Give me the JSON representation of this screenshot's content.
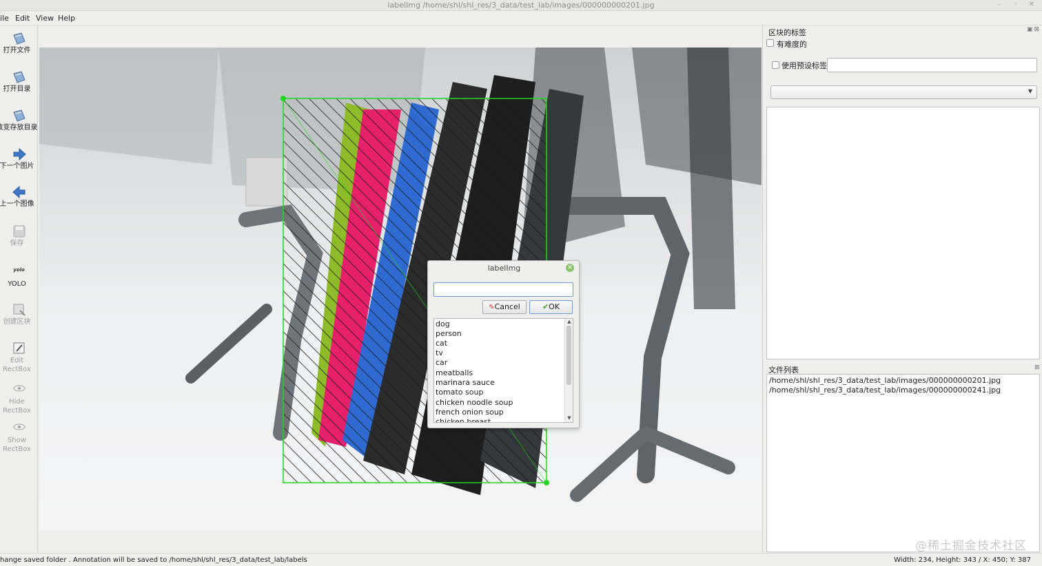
{
  "window": {
    "title": "labelImg /home/shl/shl_res/3_data/test_lab/images/000000000201.jpg",
    "controls": [
      "–",
      "◦",
      "✕"
    ]
  },
  "menu": {
    "items": [
      "ile",
      "Edit",
      "View",
      "Help"
    ]
  },
  "toolbar": {
    "open_file": "打开文件",
    "open_dir": "打开目录",
    "change_save_dir": "改变存放目录",
    "next_image": "下一个图片",
    "prev_image": "上一个图像",
    "save": "保存",
    "format_small": "yolo",
    "format": "YOLO",
    "create_box": "创建区块",
    "edit_box": [
      "Edit",
      "RectBox"
    ],
    "hide_box": [
      "Hide",
      "RectBox"
    ],
    "show_box": [
      "Show",
      "RectBox"
    ]
  },
  "dialog": {
    "title": "labelImg",
    "input_value": "",
    "cancel_label": "Cancel",
    "ok_label": "OK",
    "labels": [
      "dog",
      "person",
      "cat",
      "tv",
      "car",
      "meatballs",
      "marinara sauce",
      "tomato soup",
      "chicken noodle soup",
      "french onion soup",
      "chicken breast"
    ]
  },
  "right_panel": {
    "box_labels_title": "区块的标签",
    "difficult_label": "有难度的",
    "use_default_label": "使用预设标签",
    "default_label_value": "",
    "combo_value": "",
    "file_list_title": "文件列表",
    "files": [
      "/home/shl/shl_res/3_data/test_lab/images/000000000201.jpg",
      "/home/shl/shl_res/3_data/test_lab/images/000000000241.jpg"
    ]
  },
  "status": {
    "left": "hange saved folder . Annotation will be saved to /home/shl/shl_res/3_data/test_lab/labels",
    "right": "Width: 234, Height: 343 / X: 450; Y: 387"
  },
  "watermark": "@稀土掘金技术社区",
  "colors": {
    "bbox": "#22d622",
    "accent": "#6c9bd2",
    "ok_green": "#3a9a2a"
  }
}
